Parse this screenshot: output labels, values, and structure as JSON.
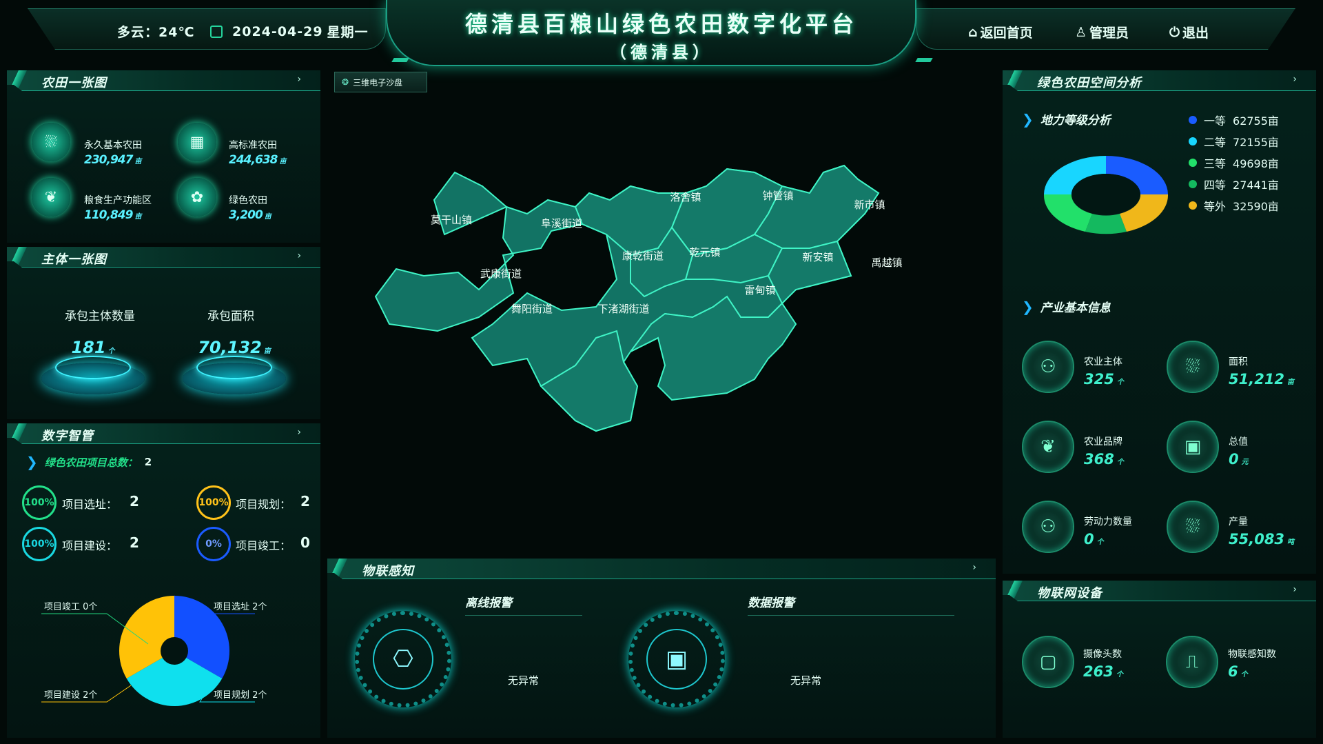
{
  "header": {
    "weather": "多云：24℃",
    "date": "2024-04-29",
    "weekday": "星期一",
    "title": "德清县百粮山绿色农田数字化平台",
    "subtitle": "（德清县）",
    "nav": {
      "home": "返回首页",
      "admin": "管理员",
      "logout": "退出"
    }
  },
  "farmland_panel": {
    "title": "农田一张图",
    "items": [
      {
        "label": "永久基本农田",
        "value": "230,947",
        "unit": "亩"
      },
      {
        "label": "高标准农田",
        "value": "244,638",
        "unit": "亩"
      },
      {
        "label": "粮食生产功能区",
        "value": "110,849",
        "unit": "亩"
      },
      {
        "label": "绿色农田",
        "value": "3,200",
        "unit": "亩"
      }
    ]
  },
  "entity_panel": {
    "title": "主体一张图",
    "contract_count_label": "承包主体数量",
    "contract_count_value": "181",
    "contract_count_unit": "个",
    "contract_area_label": "承包面积",
    "contract_area_value": "70,132",
    "contract_area_unit": "亩"
  },
  "digital_panel": {
    "title": "数字智管",
    "total_label": "绿色农田项目总数：",
    "total_value": "2",
    "progress": [
      {
        "label": "项目选址：",
        "value": "2",
        "percent": "100%",
        "color": "#22e08a"
      },
      {
        "label": "项目规划：",
        "value": "2",
        "percent": "100%",
        "color": "#ffc21a"
      },
      {
        "label": "项目建设：",
        "value": "2",
        "percent": "100%",
        "color": "#19d7e0"
      },
      {
        "label": "项目竣工：",
        "value": "0",
        "percent": "0%",
        "color": "#1b5bff"
      }
    ]
  },
  "chart_data": {
    "type": "pie",
    "categories": [
      "项目选址",
      "项目规划",
      "项目建设",
      "项目竣工"
    ],
    "values": [
      2,
      2,
      2,
      0
    ],
    "labels": [
      "项目选址 2个",
      "项目规划 2个",
      "项目建设 2个",
      "项目竣工 0个"
    ],
    "colors": [
      "#1250ff",
      "#0fe0ee",
      "#ffc207",
      "#22d67f"
    ]
  },
  "map_panel": {
    "tab": "三维电子沙盘",
    "towns": [
      "莫干山镇",
      "阜溪街道",
      "洛舍镇",
      "钟管镇",
      "新市镇",
      "康乾街道",
      "乾元镇",
      "新安镇",
      "禹越镇",
      "武康街道",
      "雷甸镇",
      "舞阳街道",
      "下渚湖街道"
    ]
  },
  "iot_panel": {
    "title": "物联感知",
    "offline_alarm_title": "离线报警",
    "offline_alarm_status": "无异常",
    "data_alarm_title": "数据报警",
    "data_alarm_status": "无异常"
  },
  "spatial_panel": {
    "title": "绿色农田空间分析",
    "sub_title": "地力等级分析",
    "grades": [
      {
        "label": "一等",
        "value": "62755亩",
        "color": "#1a5cff"
      },
      {
        "label": "二等",
        "value": "72155亩",
        "color": "#18d6ff"
      },
      {
        "label": "三等",
        "value": "49698亩",
        "color": "#22e06a"
      },
      {
        "label": "四等",
        "value": "27441亩",
        "color": "#14b95f"
      },
      {
        "label": "等外",
        "value": "32590亩",
        "color": "#f0b71a"
      }
    ]
  },
  "industry_panel": {
    "sub_title": "产业基本信息",
    "items": [
      {
        "label": "农业主体",
        "value": "325",
        "unit": "个"
      },
      {
        "label": "面积",
        "value": "51,212",
        "unit": "亩"
      },
      {
        "label": "农业品牌",
        "value": "368",
        "unit": "个"
      },
      {
        "label": "总值",
        "value": "0",
        "unit": "元"
      },
      {
        "label": "劳动力数量",
        "value": "0",
        "unit": "个"
      },
      {
        "label": "产量",
        "value": "55,083",
        "unit": "吨"
      }
    ]
  },
  "device_panel": {
    "title": "物联网设备",
    "items": [
      {
        "label": "摄像头数",
        "value": "263",
        "unit": "个"
      },
      {
        "label": "物联感知数",
        "value": "6",
        "unit": "个"
      }
    ]
  }
}
